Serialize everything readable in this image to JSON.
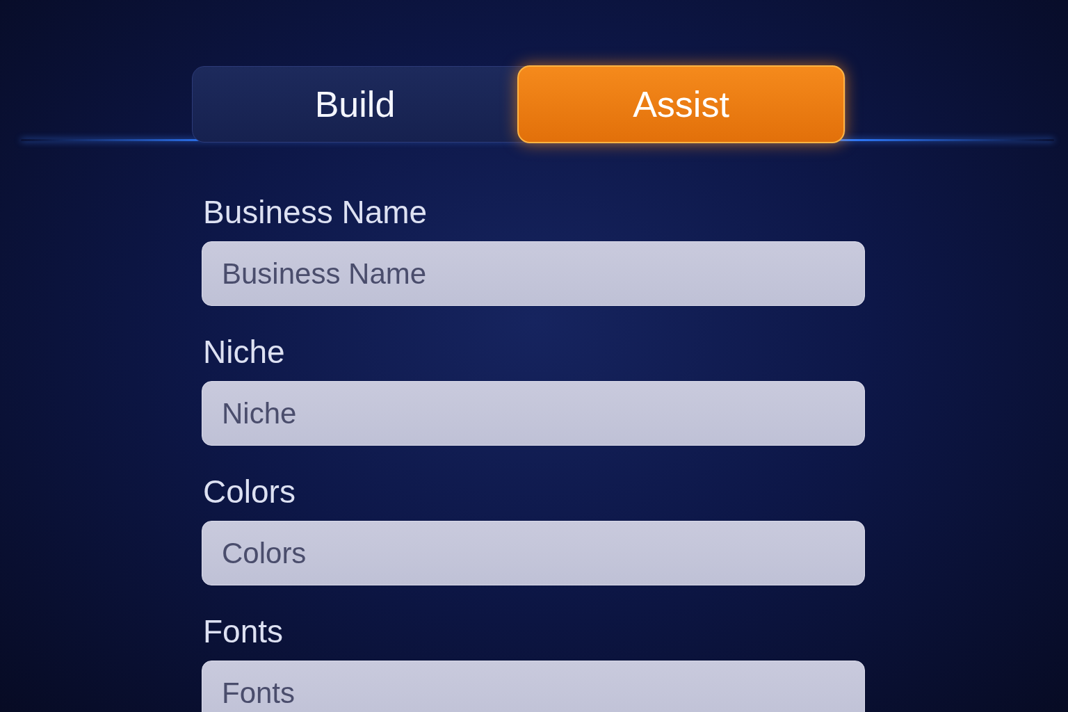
{
  "tabs": [
    {
      "label": "Build",
      "selected": false
    },
    {
      "label": "Assist",
      "selected": true
    }
  ],
  "fields": [
    {
      "label": "Business Name",
      "placeholder": "Business Name"
    },
    {
      "label": "Niche",
      "placeholder": "Niche"
    },
    {
      "label": "Colors",
      "placeholder": "Colors"
    },
    {
      "label": "Fonts",
      "placeholder": "Fonts"
    }
  ]
}
